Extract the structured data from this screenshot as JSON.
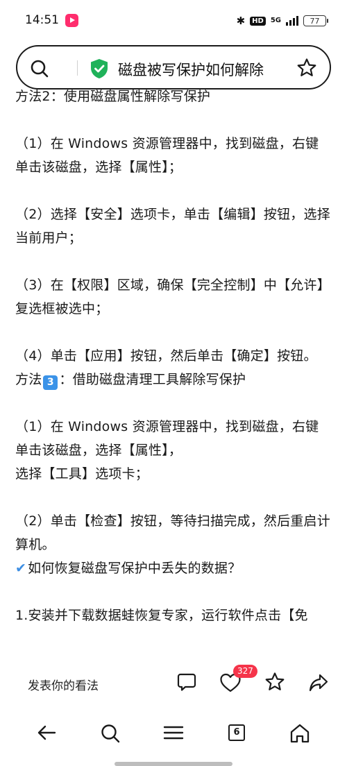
{
  "status_bar": {
    "time": "14:51",
    "network": "5G",
    "hd": "HD",
    "battery": "77"
  },
  "search": {
    "query": "磁盘被写保护如何解除"
  },
  "article": {
    "partial_top_line": "方法2：使用磁盘属性解除写保护",
    "paragraphs": [
      "（1）在 Windows 资源管理器中，找到磁盘，右键单击该磁盘，选择【属性】；",
      "（2）选择【安全】选项卡，单击【编辑】按钮，选择当前用户；",
      "（3）在【权限】区域，确保【完全控制】中【允许】复选框被选中；",
      "（4）单击【应用】按钮，然后单击【确定】按钮。"
    ],
    "method3_prefix": "方法",
    "method3_number": "3",
    "method3_text": "：借助磁盘清理工具解除写保护",
    "m3_p1_line1": "（1）在 Windows 资源管理器中，找到磁盘，右键单击该磁盘，选择【属性】，",
    "m3_p1_line2": "选择【工具】选项卡；",
    "m3_p2": "（2）单击【检查】按钮，等待扫描完成，然后重启计算机。",
    "check_mark": "✔",
    "recover_heading": "如何恢复磁盘写保护中丢失的数据？",
    "step1": "1.安装并下载数据蛙恢复专家，运行软件点击【免"
  },
  "comment_bar": {
    "placeholder": "发表你的看法",
    "like_count": "327"
  },
  "nav": {
    "tabs_count": "6"
  },
  "colors": {
    "accent_blue": "#3b93e8",
    "shield_green": "#1fb25a",
    "badge_red": "#f5344a",
    "app_badge_pink": "#ff2d6d"
  }
}
